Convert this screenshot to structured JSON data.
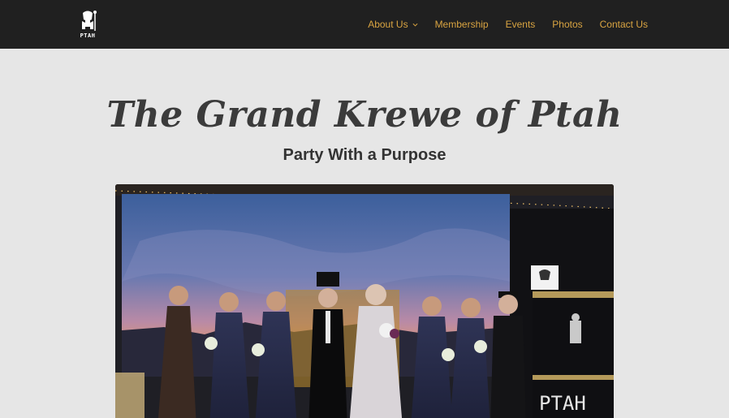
{
  "header": {
    "logo_text": "PTAH",
    "nav": [
      {
        "label": "About Us",
        "has_dropdown": true
      },
      {
        "label": "Membership"
      },
      {
        "label": "Events"
      },
      {
        "label": "Photos"
      },
      {
        "label": "Contact Us"
      }
    ]
  },
  "hero": {
    "title": "The Grand Krewe of Ptah",
    "subtitle": "Party With a Purpose",
    "banner_text": "PTAH"
  },
  "colors": {
    "header_bg": "#202020",
    "nav_link": "#d9a441",
    "page_bg": "#e6e6e6",
    "title_text": "#3b3b3b"
  }
}
